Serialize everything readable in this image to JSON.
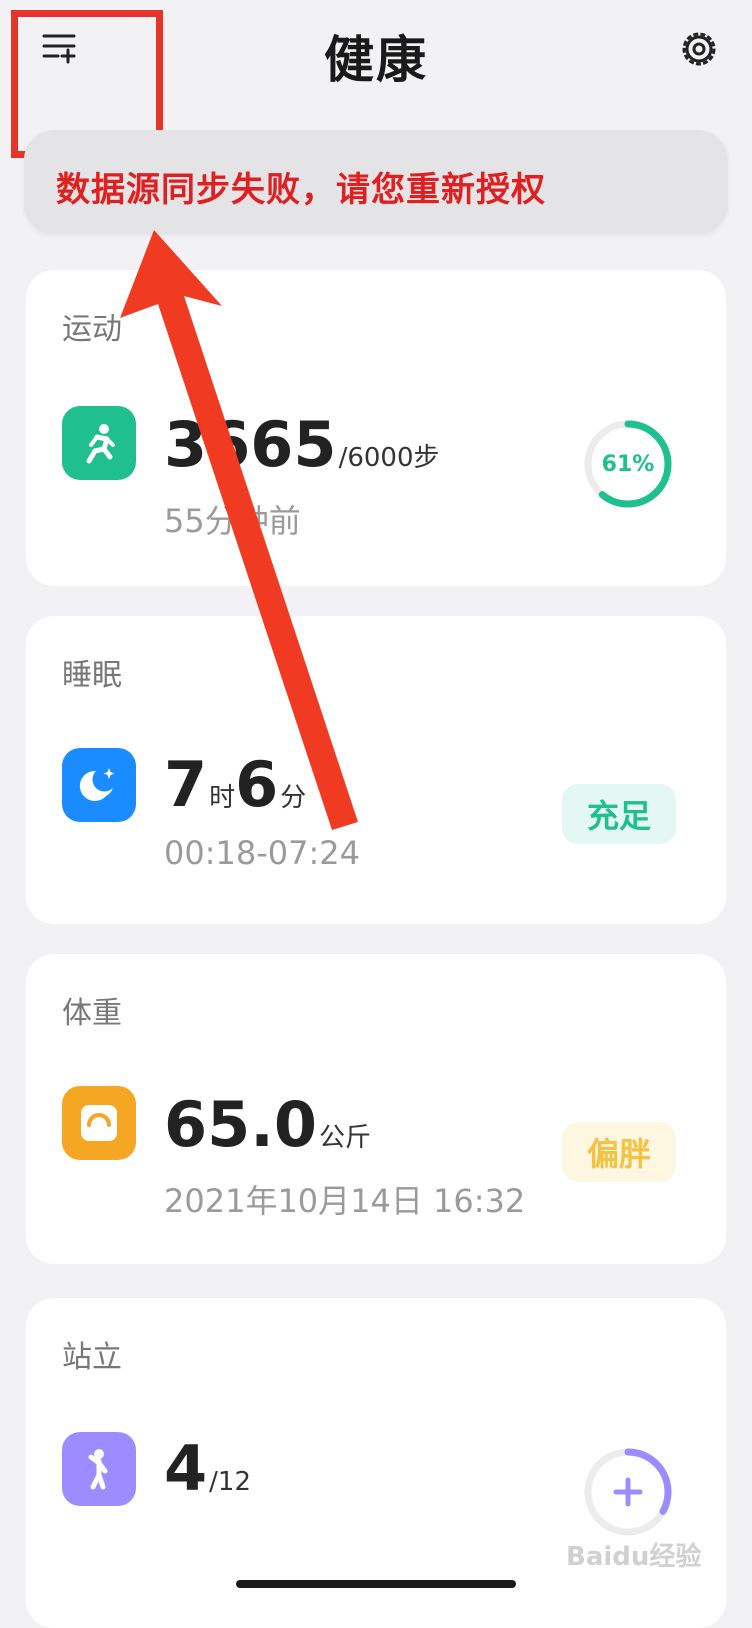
{
  "header": {
    "title": "健康",
    "menu_icon": "list-add-icon",
    "settings_icon": "gear-icon"
  },
  "banner": {
    "message": "数据源同步失败，请您重新授权"
  },
  "cards": {
    "exercise": {
      "label": "运动",
      "steps": "3665",
      "goal": "/6000步",
      "time_ago": "55分钟前",
      "progress_text": "61%",
      "progress": 0.61,
      "icon": "running-icon",
      "color": "#1fbf8f"
    },
    "sleep": {
      "label": "睡眠",
      "hours": "7",
      "hours_unit": "时",
      "minutes": "6",
      "minutes_unit": "分",
      "range": "00:18-07:24",
      "status": "充足",
      "icon": "moon-icon",
      "color": "#1a8cff"
    },
    "weight": {
      "label": "体重",
      "value": "65.0",
      "unit": "公斤",
      "time": "2021年10月14日 16:32",
      "status": "偏胖",
      "icon": "scale-icon",
      "color": "#f5a623"
    },
    "standing": {
      "label": "站立",
      "value": "4",
      "goal": "/12",
      "icon": "standing-icon",
      "color": "#9b8cff",
      "progress": 0.33
    }
  },
  "watermark": "Baidu经验"
}
